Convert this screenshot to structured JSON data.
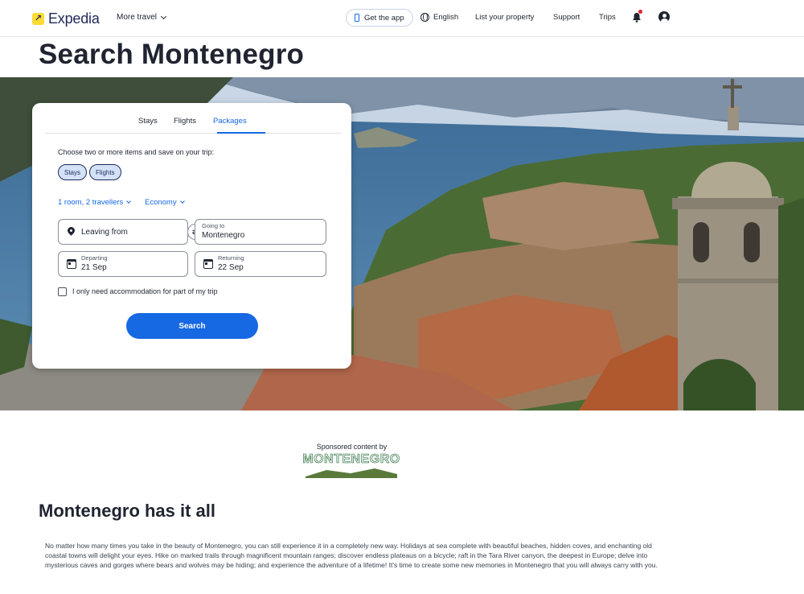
{
  "header": {
    "logo_text": "Expedia",
    "more_travel": "More travel",
    "get_app": "Get the app",
    "language": "English",
    "list_property": "List your property",
    "support": "Support",
    "trips": "Trips"
  },
  "page_title": "Search Montenegro",
  "search": {
    "tabs": [
      "Stays",
      "Flights",
      "Packages"
    ],
    "active_tab": "Packages",
    "choose_text": "Choose two or more items and save on your trip:",
    "pills": [
      "Stays",
      "Flights"
    ],
    "travellers": "1 room, 2 travellers",
    "cabin_class": "Economy",
    "leaving_from_placeholder": "Leaving from",
    "going_to_label": "Going to",
    "going_to_value": "Montenegro",
    "departing_label": "Departing",
    "departing_value": "21 Sep",
    "returning_label": "Returning",
    "returning_value": "22 Sep",
    "accommodation_checkbox": "I only need accommodation for part of my trip",
    "accommodation_checked": false,
    "search_button": "Search"
  },
  "sponsored": {
    "label": "Sponsored content by",
    "logo_text": "MONTENEGRO"
  },
  "section": {
    "title": "Montenegro has it all",
    "body": "No matter how many times you take in the beauty of Montenegro, you can still experience it in a completely new way. Holidays at sea complete with beautiful beaches, hidden coves, and enchanting old coastal towns will delight your eyes. Hike on marked trails through magnificent mountain ranges; discover endless plateaus on a bicycle; raft in the Tara River canyon, the deepest in Europe; delve into mysterious caves and gorges where bears and wolves may be hiding; and experience the adventure of a lifetime! It's time to create some new memories in Montenegro that you will always carry with you."
  },
  "colors": {
    "brand_navy": "#1e2a5a",
    "brand_yellow": "#fddb32",
    "accent_blue": "#1668e3"
  }
}
